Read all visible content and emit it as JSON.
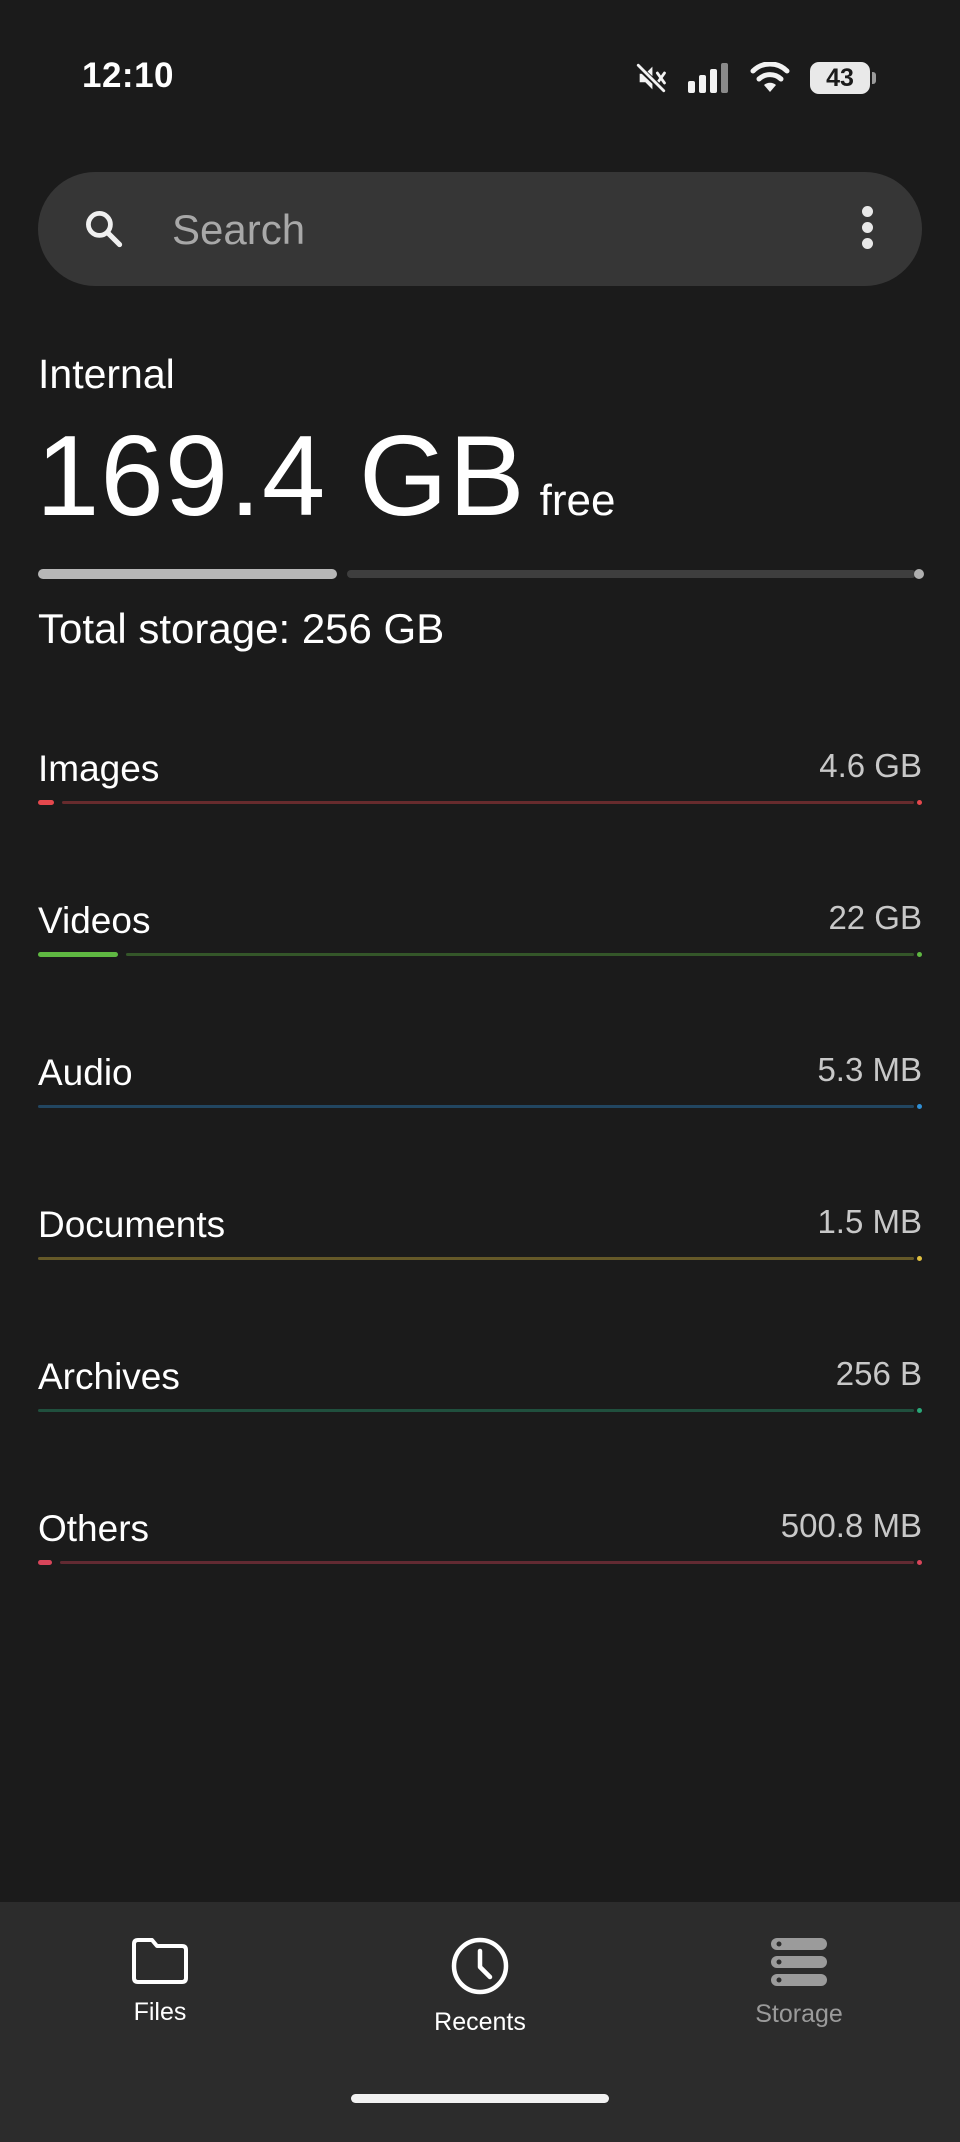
{
  "status_bar": {
    "time": "12:10",
    "battery_level": "43",
    "icons": [
      "mute-icon",
      "signal-icon",
      "wifi-icon",
      "battery-icon"
    ]
  },
  "search": {
    "placeholder": "Search",
    "icons": [
      "search-icon",
      "more-vert-icon"
    ]
  },
  "storage": {
    "label": "Internal",
    "free_value": "169.4 GB",
    "free_unit": "free",
    "used_fraction": 0.338,
    "total_text": "Total storage: 256 GB",
    "bar_color": "#b7b7b7"
  },
  "categories": [
    {
      "name": "Images",
      "size": "4.6 GB",
      "color": "#e5484d",
      "fill_fraction": 0.018
    },
    {
      "name": "Videos",
      "size": "22 GB",
      "color": "#5fb842",
      "fill_fraction": 0.09
    },
    {
      "name": "Audio",
      "size": "5.3 MB",
      "color": "#2f8fd6",
      "fill_fraction": 0.0
    },
    {
      "name": "Documents",
      "size": "1.5 MB",
      "color": "#e0c040",
      "fill_fraction": 0.0
    },
    {
      "name": "Archives",
      "size": "256 B",
      "color": "#2aa879",
      "fill_fraction": 0.0
    },
    {
      "name": "Others",
      "size": "500.8 MB",
      "color": "#d8455a",
      "fill_fraction": 0.002
    }
  ],
  "bottom_nav": {
    "items": [
      {
        "label": "Files",
        "icon": "folder-icon",
        "color": "#ffffff"
      },
      {
        "label": "Recents",
        "icon": "clock-icon",
        "color": "#ffffff"
      },
      {
        "label": "Storage",
        "icon": "storage-icon",
        "color": "#9b9b9b"
      }
    ]
  }
}
